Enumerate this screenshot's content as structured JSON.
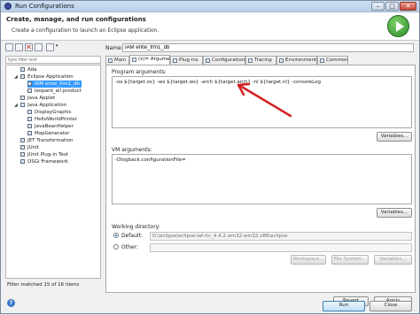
{
  "window": {
    "title": "Run Configurations",
    "min_glyph": "–",
    "max_glyph": "□",
    "close_glyph": "✕"
  },
  "header": {
    "title": "Create, manage, and run configurations",
    "description": "Create a configuration to launch an Eclipse application."
  },
  "sidebar": {
    "filter_placeholder": "type filter text",
    "items": [
      {
        "label": "Ada"
      },
      {
        "label": "Eclipse Application"
      },
      {
        "label": "IAM entw_frm1_db"
      },
      {
        "label": "leopard_all.product"
      },
      {
        "label": "Java Applet"
      },
      {
        "label": "Java Application"
      },
      {
        "label": "DisplayGraphic"
      },
      {
        "label": "HelloWorldPrinter"
      },
      {
        "label": "JavaBeanHelper"
      },
      {
        "label": "MapGenerator"
      },
      {
        "label": "JET Transformation"
      },
      {
        "label": "JUnit"
      },
      {
        "label": "JUnit Plug-in Test"
      },
      {
        "label": "OSGi Framework"
      }
    ],
    "status": "Filter matched 15 of 16 items"
  },
  "config": {
    "name_label": "Name:",
    "name_value": "IAM entw_frm1_db",
    "tabs": [
      {
        "label": "Main"
      },
      {
        "label": "(x)= Arguments"
      },
      {
        "label": "Plug-ins"
      },
      {
        "label": "Configuration"
      },
      {
        "label": "Tracing"
      },
      {
        "label": "Environment"
      },
      {
        "label": "Common"
      }
    ],
    "program_args_label": "Program arguments:",
    "program_args_value": "-os ${target.os} -ws ${target.ws} -arch ${target.arch} -nl ${target.nl} -consoleLog",
    "variables_btn": "Variables...",
    "vm_args_label": "VM arguments:",
    "vm_args_value": "-Dlogback.configurationFile=",
    "variables_btn2": "Variables...",
    "workdir_label": "Working directory:",
    "default_label": "Default:",
    "default_value": "D:\\eclipse\\eclipse-iaf-rtc_4.4.2.win32.win32.x86\\eclipse",
    "other_label": "Other:",
    "workspace_btn": "Workspace...",
    "filesystem_btn": "File System...",
    "variables_btn3": "Variables...",
    "revert_btn": "Revert",
    "apply_btn": "Apply"
  },
  "footer": {
    "run_btn": "Run",
    "close_btn": "Close",
    "help_glyph": "?"
  },
  "colors": {
    "annotation_arrow": "#d62020",
    "selection": "#3399ff",
    "run_green": "#2e8b2a"
  }
}
